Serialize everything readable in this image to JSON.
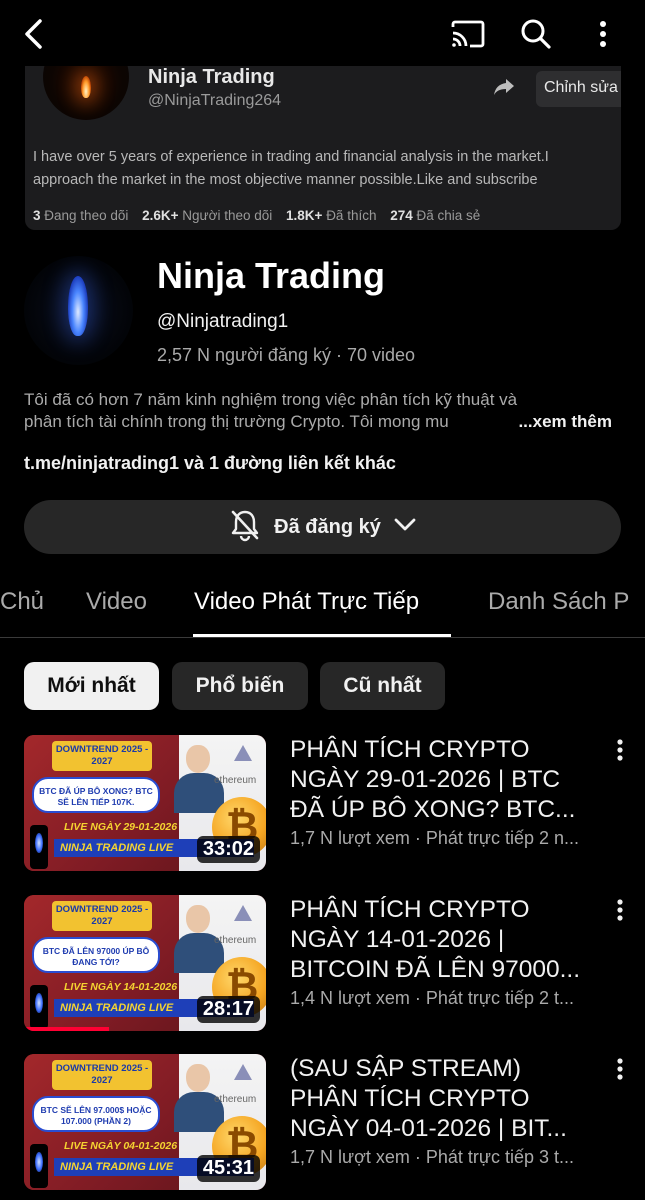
{
  "card": {
    "name": "Ninja Trading",
    "handle": "@NinjaTrading264",
    "edit_label": "Chỉnh sửa",
    "bio": "I have over 5 years of experience in trading and financial analysis in the market.I approach the market in the most objective manner possible.Like and subscribe",
    "stats": [
      {
        "num": "3",
        "label": "Đang theo dõi"
      },
      {
        "num": "2.6K+",
        "label": "Người theo dõi"
      },
      {
        "num": "1.8K+",
        "label": "Đã thích"
      },
      {
        "num": "274",
        "label": "Đã chia sẻ"
      }
    ]
  },
  "channel": {
    "name": "Ninja Trading",
    "handle": "@Ninjatrading1",
    "meta": "2,57 N người đăng ký · 70 video",
    "desc_line1": "Tôi đã có hơn 7 năm kinh nghiệm trong việc phân tích kỹ thuật và",
    "desc_line2": "phân tích tài chính trong thị trường Crypto. Tôi mong mu",
    "more_label": "...xem thêm",
    "link": "t.me/ninjatrading1 và 1 đường liên kết khác",
    "subscribe_label": "Đã đăng ký"
  },
  "tabs": [
    "Chủ",
    "Video",
    "Video Phát Trực Tiếp",
    "Danh Sách P"
  ],
  "chips": [
    "Mới nhất",
    "Phổ biến",
    "Cũ nhất"
  ],
  "videos": [
    {
      "title_lines": [
        "PHÂN TÍCH CRYPTO",
        "NGÀY 29-01-2026 | BTC",
        "ĐÃ ÚP BÔ XONG? BTC..."
      ],
      "meta": "1,7 N lượt xem · Phát trực tiếp 2 n...",
      "duration": "33:02",
      "progress": 0,
      "thumb": {
        "badge": "DOWNTREND 2025 - 2027",
        "bubble": "BTC ĐÃ ÚP BÔ XONG? BTC SẼ LÊN TIẾP 107K.",
        "live": "LIVE NGÀY 29-01-2026",
        "bar": "NINJA TRADING LIVE"
      }
    },
    {
      "title_lines": [
        "PHÂN TÍCH CRYPTO",
        "NGÀY 14-01-2026 |",
        "BITCOIN ĐÃ LÊN 97000..."
      ],
      "meta": "1,4 N lượt xem · Phát trực tiếp 2 t...",
      "duration": "28:17",
      "progress": 0.35,
      "thumb": {
        "badge": "DOWNTREND 2025 - 2027",
        "bubble": "BTC ĐÃ LÊN 97000 ÚP BÔ ĐANG TỚI?",
        "live": "LIVE NGÀY 14-01-2026",
        "bar": "NINJA TRADING LIVE"
      }
    },
    {
      "title_lines": [
        "(SAU SẬP STREAM)",
        "PHÂN TÍCH CRYPTO",
        "NGÀY 04-01-2026 | BIT..."
      ],
      "meta": "1,7 N lượt xem · Phát trực tiếp 3 t...",
      "duration": "45:31",
      "progress": 0,
      "thumb": {
        "badge": "DOWNTREND 2025 - 2027",
        "bubble": "BTC SẼ LÊN 97.000$ HOẶC 107.000 (PHẦN 2)",
        "live": "LIVE NGÀY 04-01-2026",
        "bar": "NINJA TRADING LIVE"
      }
    }
  ],
  "icons": {
    "back": "chevron-left-icon",
    "cast": "cast-icon",
    "search": "search-icon",
    "more": "more-vert-icon",
    "share": "share-arrow-icon",
    "bell": "bell-off-icon",
    "dropdown": "chevron-down-icon"
  },
  "colors": {
    "background": "#000000",
    "chip_bg": "#272727",
    "chip_active_bg": "#f1f1f1",
    "progress": "#ff0033"
  }
}
